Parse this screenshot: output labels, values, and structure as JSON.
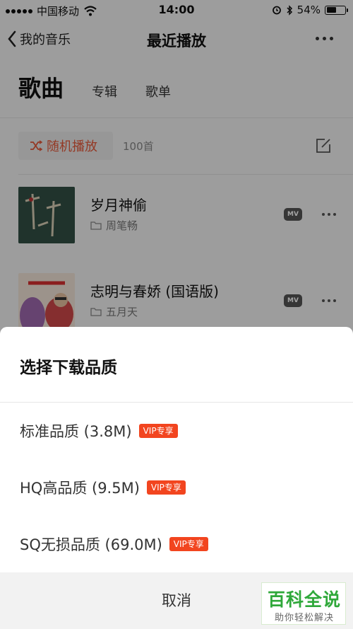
{
  "status_bar": {
    "carrier": "中国移动",
    "time": "14:00",
    "battery": "54%",
    "battery_level": 0.54
  },
  "navbar": {
    "back_label": "我的音乐",
    "title": "最近播放"
  },
  "tabs": {
    "main": "歌曲",
    "items": [
      "专辑",
      "歌单"
    ]
  },
  "toolbar": {
    "shuffle_label": "随机播放",
    "count": "100首"
  },
  "songs": [
    {
      "title": "岁月神偷",
      "artist": "周笔畅",
      "badge": "MV"
    },
    {
      "title": "志明与春娇 (国语版)",
      "artist": "五月天",
      "badge": "MV"
    }
  ],
  "sheet": {
    "title": "选择下载品质",
    "options": [
      {
        "label": "标准品质 (3.8M)",
        "badge": "VIP专享"
      },
      {
        "label": "HQ高品质 (9.5M)",
        "badge": "VIP专享"
      },
      {
        "label": "SQ无损品质 (69.0M)",
        "badge": "VIP专享"
      }
    ],
    "cancel_label": "取消"
  },
  "watermark": {
    "main": "百科全说",
    "sub": "助你轻松解决"
  },
  "colors": {
    "accent": "#e85a3a",
    "vip": "#f2451f",
    "watermark": "#2fa83a"
  }
}
